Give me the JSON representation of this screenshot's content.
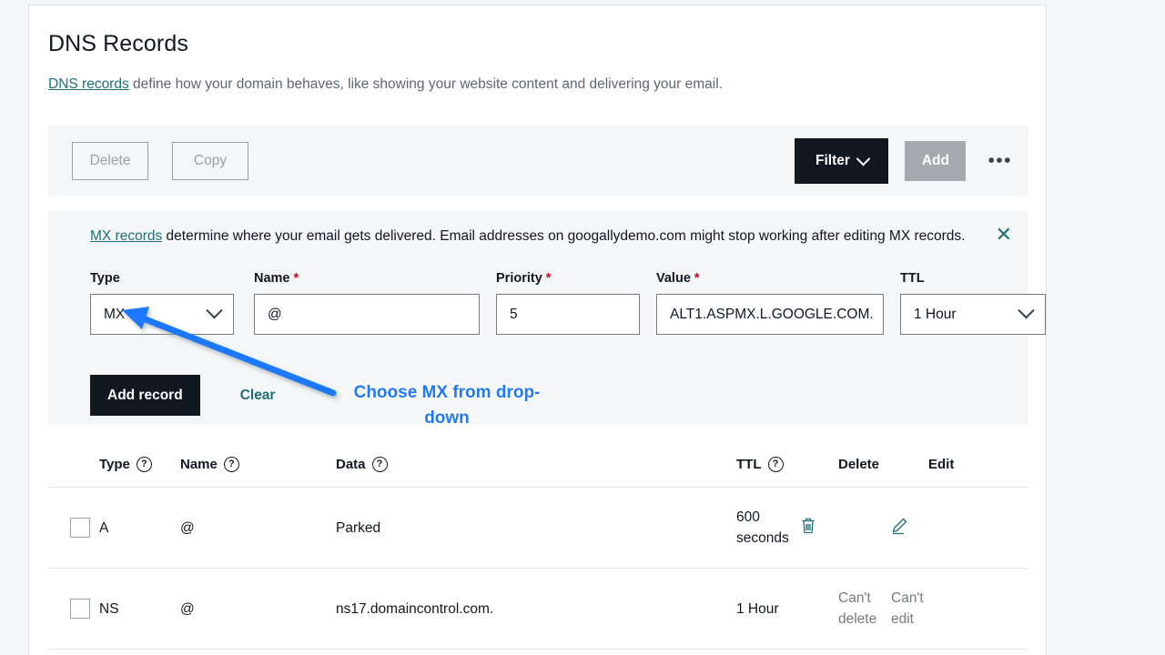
{
  "page": {
    "title": "DNS Records",
    "intro_link": "DNS records",
    "intro_text": " define how your domain behaves, like showing your website content and delivering your email."
  },
  "toolbar": {
    "delete_label": "Delete",
    "copy_label": "Copy",
    "filter_label": "Filter",
    "add_label": "Add",
    "more_label": "•••"
  },
  "mx_notice": {
    "link": "MX records",
    "text": " determine where your email gets delivered. Email addresses on googallydemo.com might stop working after editing MX records.",
    "close_label": "✕"
  },
  "form": {
    "type": {
      "label": "Type",
      "value": "MX",
      "required": false
    },
    "name": {
      "label": "Name",
      "value": "@",
      "required": true,
      "required_mark": "*"
    },
    "priority": {
      "label": "Priority",
      "value": "5",
      "required": true,
      "required_mark": "*"
    },
    "value": {
      "label": "Value",
      "value": "ALT1.ASPMX.L.GOOGLE.COM.",
      "required": true,
      "required_mark": "*"
    },
    "ttl": {
      "label": "TTL",
      "value": "1 Hour",
      "required": false
    },
    "add_record_label": "Add record",
    "clear_label": "Clear"
  },
  "table": {
    "headers": {
      "type": "Type",
      "name": "Name",
      "data": "Data",
      "ttl": "TTL",
      "delete": "Delete",
      "edit": "Edit",
      "help_glyph": "?"
    },
    "rows": [
      {
        "type": "A",
        "name": "@",
        "data": "Parked",
        "ttl": "600 seconds",
        "delete": "",
        "edit": "",
        "deletable": true,
        "editable": true
      },
      {
        "type": "NS",
        "name": "@",
        "data": "ns17.domaincontrol.com.",
        "ttl": "1 Hour",
        "delete": "Can't delete",
        "edit": "Can't edit",
        "deletable": false,
        "editable": false
      }
    ]
  },
  "annotation": {
    "text": "Choose MX from drop-down",
    "color": "#1f78ff"
  },
  "colors": {
    "page_bg": "#f4f6f7",
    "card_bg": "#ffffff",
    "accent_teal": "#1f6f78",
    "dark_button": "#111820",
    "disabled_gray": "#a3a9ad",
    "required_red": "#d0021b",
    "annotation_blue": "#1f78ff"
  }
}
